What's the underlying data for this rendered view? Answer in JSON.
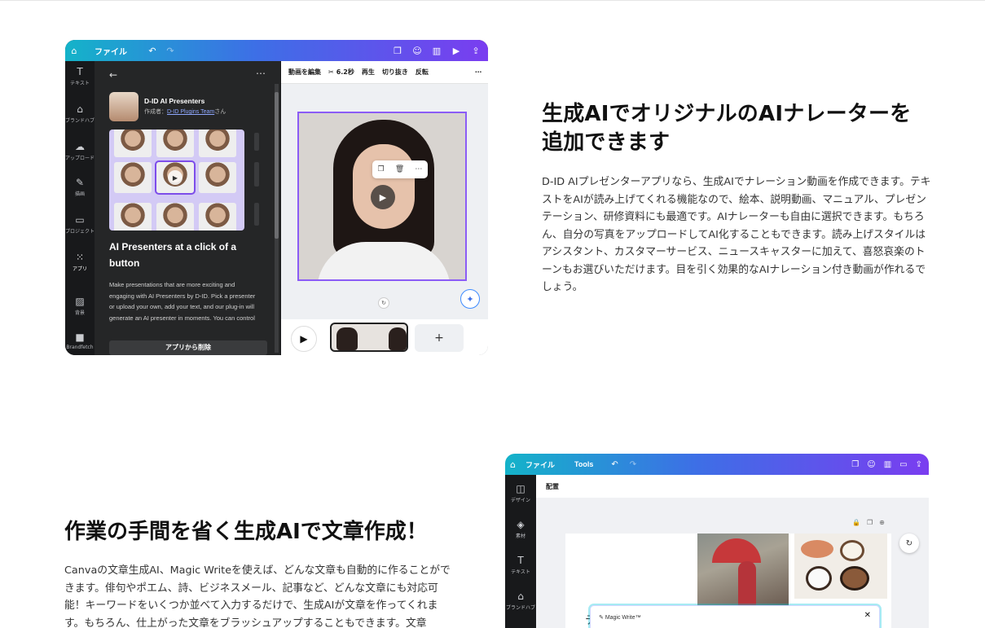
{
  "section1": {
    "heading_line1": "生成AIでオリジナルのAIナレーターを",
    "heading_line2": "追加できます",
    "body": "D-ID AIプレゼンターアプリなら、生成AIでナレーション動画を作成できます。テキストをAIが読み上げてくれる機能なので、絵本、説明動画、マニュアル、プレゼンテーション、研修資料にも最適です。AIナレーターも自由に選択できます。もちろん、自分の写真をアップロードしてAI化することもできます。読み上げスタイルはアシスタント、カスタマーサービス、ニュースキャスターに加えて、喜怒哀楽のトーンもお選びいただけます。目を引く効果的なAIナレーション付き動画が作れるでしょう。"
  },
  "section2": {
    "heading": "作業の手間を省く生成AIで文章作成！",
    "body": "Canvaの文章生成AI、Magic Writeを使えば、どんな文章も自動的に作ることができます。俳句やポエム、詩、ビジネスメール、記事など、どんな文章にも対応可能！キーワードをいくつか並べて入力するだけで、生成AIが文章を作ってくれます。もちろん、仕上がった文章をブラッシュアップすることもできます。文章"
  },
  "shot1": {
    "topbar": {
      "file": "ファイル"
    },
    "rail": [
      "テキスト",
      "ブランドハブ",
      "アップロード",
      "描画",
      "プロジェクト",
      "アプリ",
      "背景",
      "Brandfetch"
    ],
    "app_name": "D-ID AI Presenters",
    "app_by_prefix": "作成者：",
    "app_by_link": "D-ID Plugins Team",
    "app_by_suffix": "さん",
    "panel_title": "AI Presenters at a click of a button",
    "panel_desc": "Make presentations that are more exciting and engaging with AI Presenters by D-ID. Pick a presenter or upload your own, add your text, and our plug-in will generate an AI presenter in moments. You can control",
    "remove_button": "アプリから削除",
    "canvas_toolbar": [
      "動画を編集",
      "6.2秒",
      "再生",
      "切り抜き",
      "反転"
    ],
    "timeline_add": "+"
  },
  "shot2": {
    "topbar": {
      "file": "ファイル",
      "tools": "Tools"
    },
    "rail": [
      "デザイン",
      "素材",
      "テキスト",
      "ブランドハブ"
    ],
    "subheader": "配置",
    "magic_write_label": "Magic Write™",
    "close": "✕"
  },
  "colors": {
    "accent_purple": "#8b5cf6",
    "gradient_start": "#14b3c9",
    "gradient_end": "#7a3df0"
  }
}
